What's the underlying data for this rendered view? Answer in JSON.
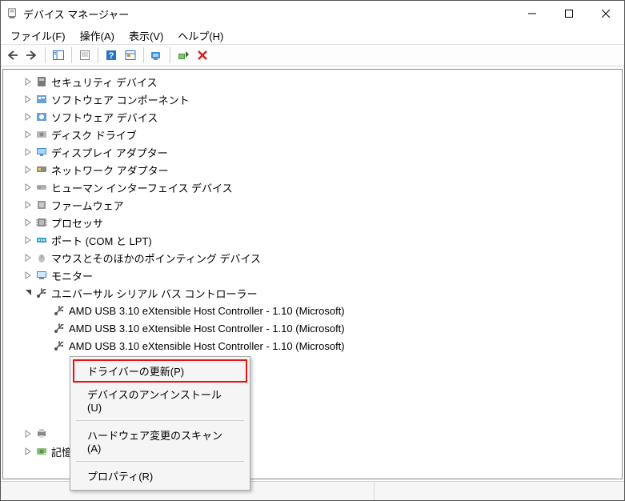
{
  "window": {
    "title": "デバイス マネージャー"
  },
  "menubar": {
    "file": "ファイル(F)",
    "action": "操作(A)",
    "view": "表示(V)",
    "help": "ヘルプ(H)"
  },
  "tree": {
    "categories": [
      {
        "label": "セキュリティ デバイス",
        "expanded": false,
        "icon": "security"
      },
      {
        "label": "ソフトウェア コンポーネント",
        "expanded": false,
        "icon": "software-comp"
      },
      {
        "label": "ソフトウェア デバイス",
        "expanded": false,
        "icon": "software-dev"
      },
      {
        "label": "ディスク ドライブ",
        "expanded": false,
        "icon": "disk"
      },
      {
        "label": "ディスプレイ アダプター",
        "expanded": false,
        "icon": "display"
      },
      {
        "label": "ネットワーク アダプター",
        "expanded": false,
        "icon": "network"
      },
      {
        "label": "ヒューマン インターフェイス デバイス",
        "expanded": false,
        "icon": "hid"
      },
      {
        "label": "ファームウェア",
        "expanded": false,
        "icon": "firmware"
      },
      {
        "label": "プロセッサ",
        "expanded": false,
        "icon": "cpu"
      },
      {
        "label": "ポート (COM と LPT)",
        "expanded": false,
        "icon": "port"
      },
      {
        "label": "マウスとそのほかのポインティング デバイス",
        "expanded": false,
        "icon": "mouse"
      },
      {
        "label": "モニター",
        "expanded": false,
        "icon": "monitor"
      },
      {
        "label": "ユニバーサル シリアル バス コントローラー",
        "expanded": true,
        "icon": "usb",
        "children": [
          {
            "label": "AMD USB 3.10 eXtensible Host Controller - 1.10 (Microsoft)",
            "icon": "usb-ctrl"
          },
          {
            "label": "AMD USB 3.10 eXtensible Host Controller - 1.10 (Microsoft)",
            "icon": "usb-ctrl"
          },
          {
            "label": "AMD USB 3.10 eXtensible Host Controller - 1.10 (Microsoft)",
            "icon": "usb-ctrl"
          }
        ]
      },
      {
        "label": "",
        "expanded": false,
        "icon": "print",
        "obscured": true
      },
      {
        "label": "記憶域コントローラー",
        "expanded": false,
        "icon": "storage"
      }
    ]
  },
  "contextMenu": {
    "items": [
      {
        "label": "ドライバーの更新(P)",
        "highlighted": true
      },
      {
        "label": "デバイスのアンインストール(U)"
      },
      {
        "sep": true
      },
      {
        "label": "ハードウェア変更のスキャン(A)"
      },
      {
        "sep": true
      },
      {
        "label": "プロパティ(R)"
      }
    ]
  }
}
